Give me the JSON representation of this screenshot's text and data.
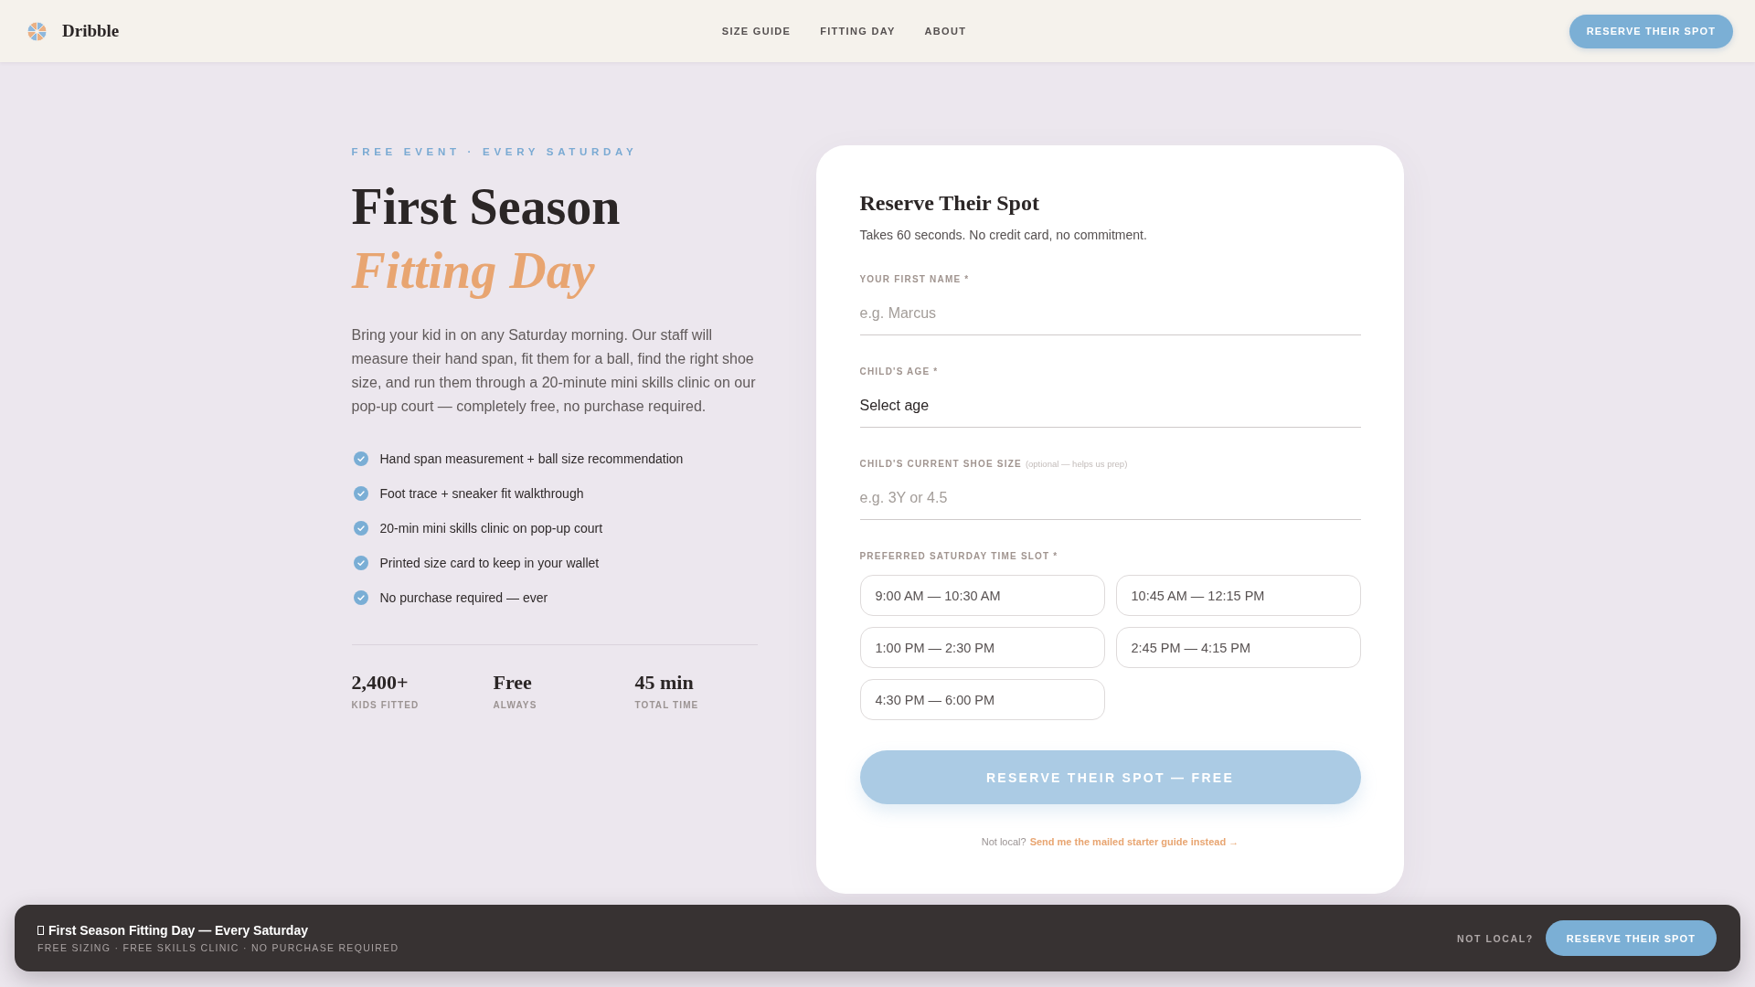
{
  "header": {
    "brand": "Dribble",
    "nav": [
      {
        "label": "SIZE GUIDE"
      },
      {
        "label": "FITTING DAY"
      },
      {
        "label": "ABOUT"
      }
    ],
    "cta": "RESERVE THEIR SPOT"
  },
  "hero": {
    "eyebrow": "FREE EVENT · EVERY SATURDAY",
    "title": "First Season",
    "title_accent": "Fitting Day",
    "intro": "Bring your kid in on any Saturday morning. Our staff will measure their hand span, fit them for a ball, find the right shoe size, and run them through a 20-minute mini skills clinic on our pop-up court — completely free, no purchase required.",
    "features": [
      "Hand span measurement + ball size recommendation",
      "Foot trace + sneaker fit walkthrough",
      "20-min mini skills clinic on pop-up court",
      "Printed size card to keep in your wallet",
      "No purchase required — ever"
    ],
    "stats": [
      {
        "value": "2,400+",
        "label": "KIDS FITTED"
      },
      {
        "value": "Free",
        "label": "ALWAYS"
      },
      {
        "value": "45 min",
        "label": "TOTAL TIME"
      }
    ]
  },
  "form": {
    "title": "Reserve Their Spot",
    "subtitle": "Takes 60 seconds. No credit card, no commitment.",
    "fields": [
      {
        "kind": "text",
        "label": "YOUR FIRST NAME *",
        "placeholder": "e.g. Marcus"
      },
      {
        "kind": "select",
        "label": "CHILD'S AGE *",
        "value": "Select age"
      },
      {
        "kind": "text",
        "label": "CHILD'S CURRENT SHOE SIZE",
        "note": "(optional — helps us prep)",
        "placeholder": "e.g. 3Y or 4.5"
      }
    ],
    "slots_label": "PREFERRED SATURDAY TIME SLOT *",
    "slots": [
      {
        "label": "9:00 AM — 10:30 AM",
        "selected": false
      },
      {
        "label": "10:45 AM — 12:15 PM",
        "selected": false
      },
      {
        "label": "1:00 PM — 2:30 PM",
        "selected": false
      },
      {
        "label": "2:45 PM — 4:15 PM",
        "selected": false
      },
      {
        "label": "4:30 PM — 6:00 PM",
        "selected": false
      }
    ],
    "submit": {
      "label": "RESERVE THEIR SPOT — FREE",
      "disabled": true
    },
    "footer_text": "Not local?",
    "footer_link": "Send me the mailed starter guide instead →"
  },
  "sticky_bar": {
    "title": "First Season Fitting Day — Every Saturday",
    "subtitle": "FREE SIZING · FREE SKILLS CLINIC · NO PURCHASE REQUIRED",
    "aside": "NOT LOCAL?",
    "cta": "RESERVE THEIR SPOT"
  }
}
